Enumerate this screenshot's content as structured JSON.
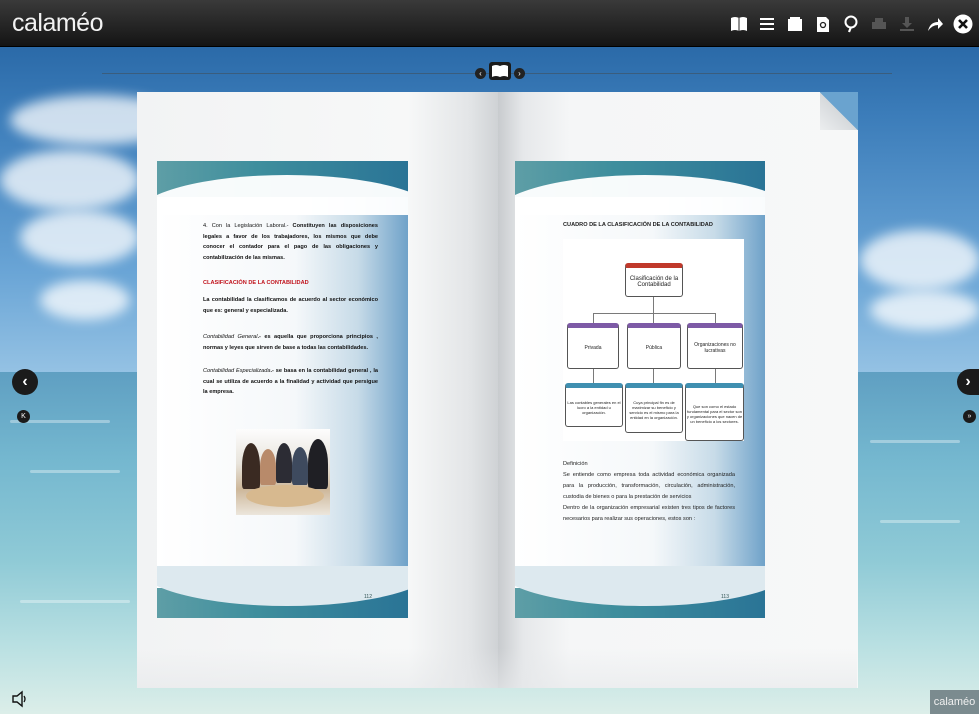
{
  "app": {
    "logo": "calaméo",
    "brand_corner": "calaméo"
  },
  "toolbar": {
    "icons": [
      "book-icon",
      "list-icon",
      "fullscreen-icon",
      "page-search-icon",
      "zoom-search-icon",
      "print-icon",
      "download-icon",
      "share-icon",
      "close-icon"
    ]
  },
  "left_page": {
    "intro_label": "4. Con la Legislación Laboral.-",
    "intro_bold": "Constituyen las disposiciones legales a favor de los trabajadores, los mismos que debe conocer el contador para el pago de las obligaciones y contabilización de las mismas.",
    "heading": "CLASIFICACIÓN DE LA CONTABILIDAD",
    "para1": "La contabilidad la clasificamos de acuerdo al sector económico que es: general y especializada.",
    "para2_label": "Contabilidad General",
    "para2": ".- es aquella que proporciona principios , normas y leyes que sirven de base a todas las contabilidades.",
    "para3_label": "Contabilidad Especializada",
    "para3": ".- se basa en la contabilidad general , la cual se utiliza de acuerdo a la finalidad y actividad que persigue la empresa.",
    "page_number": "112"
  },
  "right_page": {
    "heading": "CUADRO DE LA CLASIFICACIÓN DE LA CONTABILIDAD",
    "diagram": {
      "root": "Clasificación de la Contabilidad",
      "mid": [
        "Privada",
        "Pública",
        "Organizaciones no lucrativas"
      ],
      "leaves": [
        "Las contables generales en el lucro a la entidad u organización.",
        "Cuya principal fin es de maximizar su beneficio y servicio es el mismo para la entidad en la organización.",
        "Que son como el estado fundamental para el sector son y organizaciones que nacen de un beneficio a los sectores."
      ]
    },
    "def_heading": "Definición",
    "def_text": "Se entiende como empresa toda actividad económica organizada para la producción, transformación, circulación, administración, custodia de bienes o para la prestación de servicios",
    "def_text2": "Dentro de la organización empresarial existen tres tipos de factores necesarios para realizar sus operaciones, estos son :",
    "page_number": "113"
  },
  "navigation": {
    "prev_symbol": "‹",
    "next_symbol": "›",
    "first_symbol": "K",
    "last_symbol": "»",
    "center_left": "‹",
    "center_right": "›"
  }
}
